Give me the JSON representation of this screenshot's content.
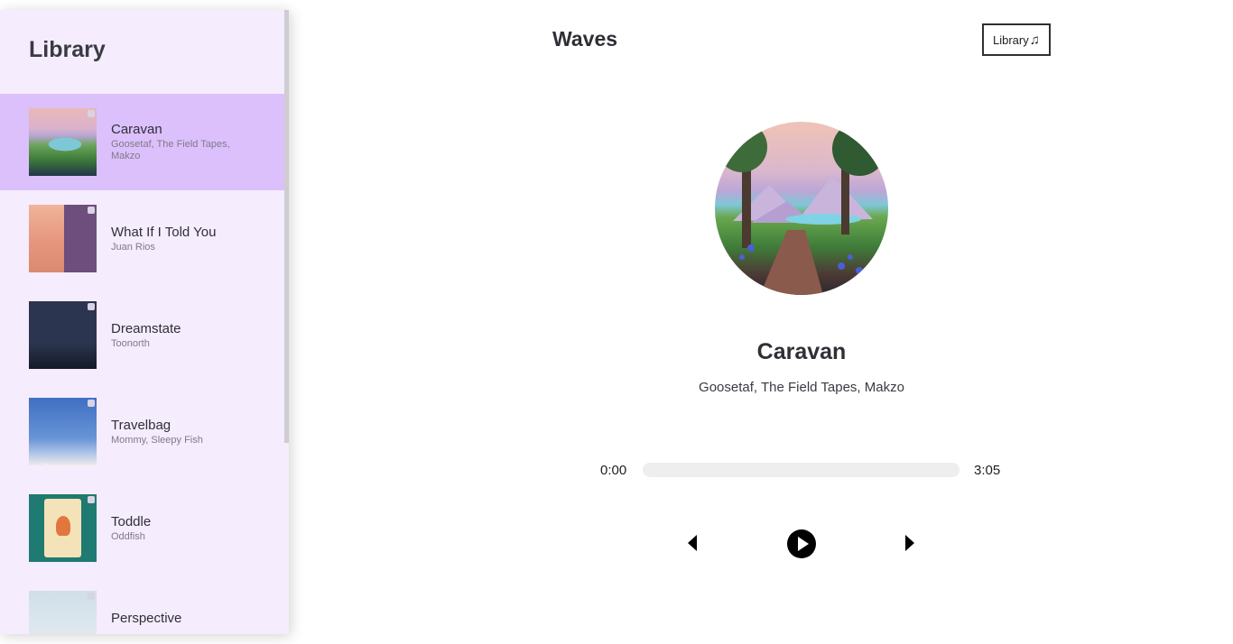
{
  "sidebar": {
    "title": "Library",
    "songs": [
      {
        "name": "Caravan",
        "artist": "Goosetaf, The Field Tapes, Makzo",
        "active": true
      },
      {
        "name": "What If I Told You",
        "artist": "Juan Rios",
        "active": false
      },
      {
        "name": "Dreamstate",
        "artist": "Toonorth",
        "active": false
      },
      {
        "name": "Travelbag",
        "artist": "Mommy, Sleepy Fish",
        "active": false
      },
      {
        "name": "Toddle",
        "artist": "Oddfish",
        "active": false
      },
      {
        "name": "Perspective",
        "artist": "",
        "active": false
      }
    ]
  },
  "header": {
    "title": "Waves",
    "library_button": "Library",
    "library_button_icon": "music-note-icon"
  },
  "player": {
    "song_name": "Caravan",
    "artist": "Goosetaf, The Field Tapes, Makzo",
    "current_time": "0:00",
    "duration": "3:05",
    "progress": 0,
    "controls": [
      "prev-icon",
      "play-icon",
      "next-icon"
    ]
  },
  "colors": {
    "sidebar_bg": "#f5ecfd",
    "active_song_bg": "#dcc0fc",
    "track_bg": "#eeeeee",
    "text": "#2f2f36"
  }
}
